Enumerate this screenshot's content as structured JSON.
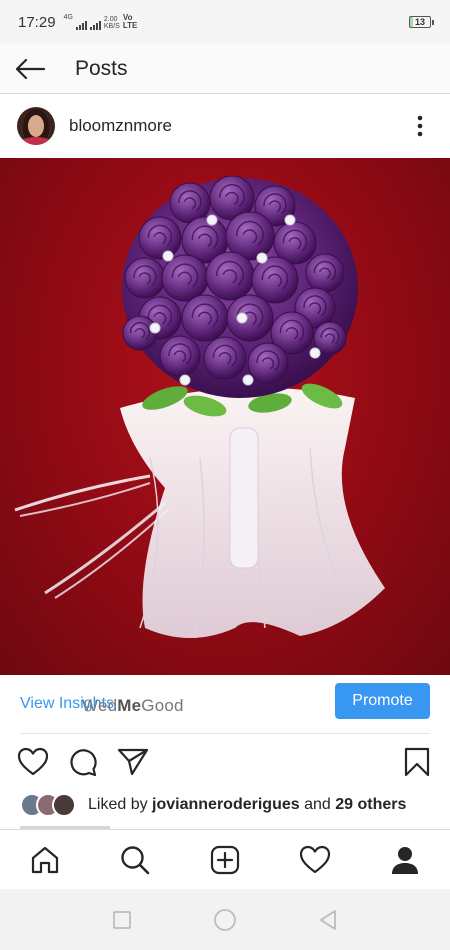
{
  "status_bar": {
    "time": "17:29",
    "network_type": "4G",
    "speed_value": "2.00",
    "speed_unit": "KB/S",
    "volte_top": "Vo",
    "volte_bottom": "LTE",
    "battery_level": "13",
    "battery_fill_percent": 13
  },
  "header": {
    "title": "Posts",
    "back_icon": "arrow-left-icon"
  },
  "post": {
    "username": "bloomznmore",
    "more_icon": "more-vertical-icon",
    "image_subject": "purple satin rose bouquet with white tulle on red background"
  },
  "insights": {
    "view_label": "View Insights",
    "watermark_pre": "Wed",
    "watermark_bold": "Me",
    "watermark_post": "Good",
    "promote_label": "Promote",
    "accent_color": "#3897f0"
  },
  "actions": {
    "like_icon": "heart-icon",
    "comment_icon": "comment-icon",
    "share_icon": "send-icon",
    "save_icon": "bookmark-icon"
  },
  "likes": {
    "prefix": "Liked by",
    "user": "jovianneroderigues",
    "conjunction": "and",
    "others": "29 others"
  },
  "bottom_nav": {
    "items": [
      "home-icon",
      "search-icon",
      "add-post-icon",
      "activity-heart-icon",
      "profile-icon"
    ]
  },
  "system_nav": {
    "items": [
      "recents-square-icon",
      "home-circle-icon",
      "back-triangle-icon"
    ]
  }
}
